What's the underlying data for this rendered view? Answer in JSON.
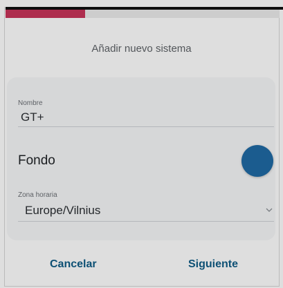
{
  "progress": {
    "fraction": 0.29,
    "color": "#c8345a"
  },
  "dialog": {
    "title": "Añadir nuevo sistema"
  },
  "form": {
    "name": {
      "label": "Nombre",
      "value": "GT+"
    },
    "background": {
      "label": "Fondo",
      "color": "#1f6aa5"
    },
    "timezone": {
      "label": "Zona horaria",
      "value": "Europe/Vilnius",
      "icon": "chevron-down-icon"
    }
  },
  "actions": {
    "cancel_label": "Cancelar",
    "next_label": "Siguiente",
    "accent": "#0f5c86"
  }
}
